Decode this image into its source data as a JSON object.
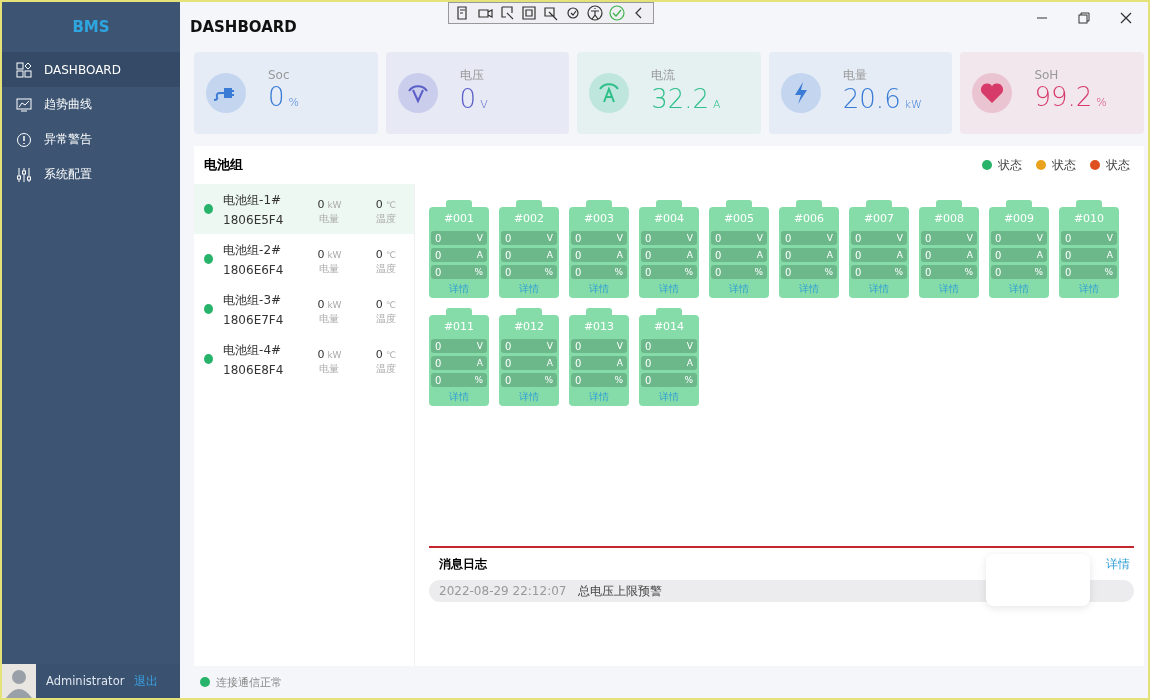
{
  "sidebar": {
    "brand": "BMS",
    "items": [
      {
        "label": "DASHBOARD",
        "selected": true
      },
      {
        "label": "趋势曲线",
        "selected": false
      },
      {
        "label": "异常警告",
        "selected": false
      },
      {
        "label": "系统配置",
        "selected": false
      }
    ],
    "user": {
      "name": "Administrator",
      "logout": "退出"
    }
  },
  "title": "DASHBOARD",
  "stats": [
    {
      "label": "Soc",
      "value": "0",
      "unit": "%",
      "color": "#3a7bd5"
    },
    {
      "label": "电压",
      "value": "0",
      "unit": "V",
      "color": "#5a5fc8"
    },
    {
      "label": "电流",
      "value": "32.2",
      "unit": "A",
      "color": "#2fbf8a"
    },
    {
      "label": "电量",
      "value": "20.6",
      "unit": "kW",
      "color": "#3a7bd5"
    },
    {
      "label": "SoH",
      "value": "99.2",
      "unit": "%",
      "color": "#d63b6a"
    }
  ],
  "panel": {
    "title": "电池组",
    "legend": [
      {
        "label": "状态",
        "color": "#27b36a"
      },
      {
        "label": "状态",
        "color": "#e9a21c"
      },
      {
        "label": "状态",
        "color": "#e0501e"
      }
    ],
    "groups": [
      {
        "name": "电池组-1#",
        "code": "1806E5F4",
        "color": "#27b36a",
        "selected": true,
        "power": "0",
        "power_unit": "kW",
        "power_label": "电量",
        "temp": "0",
        "temp_unit": "℃",
        "temp_label": "温度"
      },
      {
        "name": "电池组-2#",
        "code": "1806E6F4",
        "color": "#27b36a",
        "selected": false,
        "power": "0",
        "power_unit": "kW",
        "power_label": "电量",
        "temp": "0",
        "temp_unit": "℃",
        "temp_label": "温度"
      },
      {
        "name": "电池组-3#",
        "code": "1806E7F4",
        "color": "#27b36a",
        "selected": false,
        "power": "0",
        "power_unit": "kW",
        "power_label": "电量",
        "temp": "0",
        "temp_unit": "℃",
        "temp_label": "温度"
      },
      {
        "name": "电池组-4#",
        "code": "1806E8F4",
        "color": "#27b36a",
        "selected": false,
        "power": "0",
        "power_unit": "kW",
        "power_label": "电量",
        "temp": "0",
        "temp_unit": "℃",
        "temp_label": "温度"
      }
    ],
    "cells": [
      {
        "id": "#001",
        "rows": [
          {
            "value": "0",
            "unit": "V"
          },
          {
            "value": "0",
            "unit": "A"
          },
          {
            "value": "0",
            "unit": "%"
          }
        ],
        "link": "详情"
      },
      {
        "id": "#002",
        "rows": [
          {
            "value": "0",
            "unit": "V"
          },
          {
            "value": "0",
            "unit": "A"
          },
          {
            "value": "0",
            "unit": "%"
          }
        ],
        "link": "详情"
      },
      {
        "id": "#003",
        "rows": [
          {
            "value": "0",
            "unit": "V"
          },
          {
            "value": "0",
            "unit": "A"
          },
          {
            "value": "0",
            "unit": "%"
          }
        ],
        "link": "详情"
      },
      {
        "id": "#004",
        "rows": [
          {
            "value": "0",
            "unit": "V"
          },
          {
            "value": "0",
            "unit": "A"
          },
          {
            "value": "0",
            "unit": "%"
          }
        ],
        "link": "详情"
      },
      {
        "id": "#005",
        "rows": [
          {
            "value": "0",
            "unit": "V"
          },
          {
            "value": "0",
            "unit": "A"
          },
          {
            "value": "0",
            "unit": "%"
          }
        ],
        "link": "详情"
      },
      {
        "id": "#006",
        "rows": [
          {
            "value": "0",
            "unit": "V"
          },
          {
            "value": "0",
            "unit": "A"
          },
          {
            "value": "0",
            "unit": "%"
          }
        ],
        "link": "详情"
      },
      {
        "id": "#007",
        "rows": [
          {
            "value": "0",
            "unit": "V"
          },
          {
            "value": "0",
            "unit": "A"
          },
          {
            "value": "0",
            "unit": "%"
          }
        ],
        "link": "详情"
      },
      {
        "id": "#008",
        "rows": [
          {
            "value": "0",
            "unit": "V"
          },
          {
            "value": "0",
            "unit": "A"
          },
          {
            "value": "0",
            "unit": "%"
          }
        ],
        "link": "详情"
      },
      {
        "id": "#009",
        "rows": [
          {
            "value": "0",
            "unit": "V"
          },
          {
            "value": "0",
            "unit": "A"
          },
          {
            "value": "0",
            "unit": "%"
          }
        ],
        "link": "详情"
      },
      {
        "id": "#010",
        "rows": [
          {
            "value": "0",
            "unit": "V"
          },
          {
            "value": "0",
            "unit": "A"
          },
          {
            "value": "0",
            "unit": "%"
          }
        ],
        "link": "详情"
      },
      {
        "id": "#011",
        "rows": [
          {
            "value": "0",
            "unit": "V"
          },
          {
            "value": "0",
            "unit": "A"
          },
          {
            "value": "0",
            "unit": "%"
          }
        ],
        "link": "详情"
      },
      {
        "id": "#012",
        "rows": [
          {
            "value": "0",
            "unit": "V"
          },
          {
            "value": "0",
            "unit": "A"
          },
          {
            "value": "0",
            "unit": "%"
          }
        ],
        "link": "详情"
      },
      {
        "id": "#013",
        "rows": [
          {
            "value": "0",
            "unit": "V"
          },
          {
            "value": "0",
            "unit": "A"
          },
          {
            "value": "0",
            "unit": "%"
          }
        ],
        "link": "详情"
      },
      {
        "id": "#014",
        "rows": [
          {
            "value": "0",
            "unit": "V"
          },
          {
            "value": "0",
            "unit": "A"
          },
          {
            "value": "0",
            "unit": "%"
          }
        ],
        "link": "详情"
      }
    ],
    "log": {
      "title": "消息日志",
      "link": "详情",
      "entries": [
        {
          "time": "2022-08-29 22:12:07",
          "message": "总电压上限预警"
        }
      ]
    }
  },
  "status": {
    "text": "连接通信正常",
    "color": "#27b36a"
  }
}
